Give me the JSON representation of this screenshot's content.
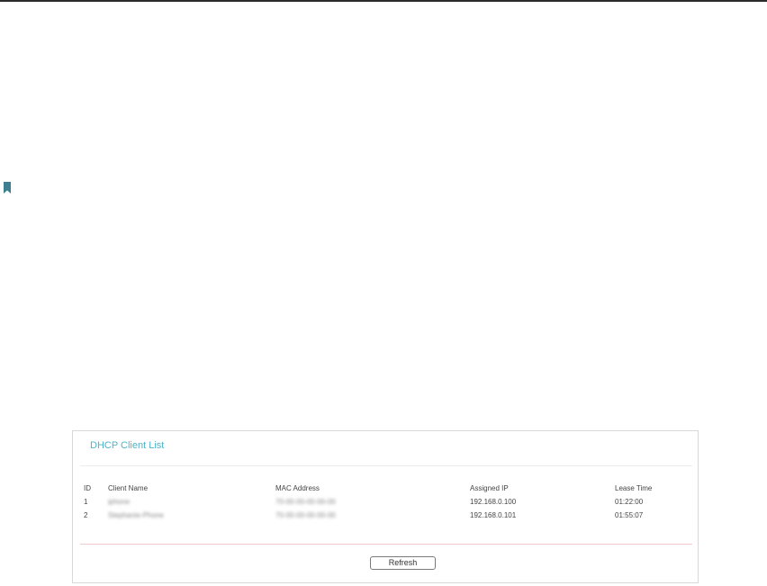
{
  "panel": {
    "title": "DHCP Client List",
    "refresh_label": "Refresh"
  },
  "table": {
    "columns": [
      "ID",
      "Client Name",
      "MAC Address",
      "Assigned IP",
      "Lease Time"
    ],
    "rows": [
      {
        "id": "1",
        "client_name": "iphone",
        "mac": "70-00-00-00-00-00",
        "ip": "192.168.0.100",
        "lease": "01:22:00"
      },
      {
        "id": "2",
        "client_name": "Stephanie-Phone",
        "mac": "70-00-00-00-00-00",
        "ip": "192.168.0.101",
        "lease": "01:55:07"
      }
    ]
  },
  "colors": {
    "accent": "#4fb3c9",
    "bookmark": "#3d7f8f",
    "separator": "#f2c9c9"
  },
  "icons": {
    "bookmark": "bookmark-icon"
  }
}
